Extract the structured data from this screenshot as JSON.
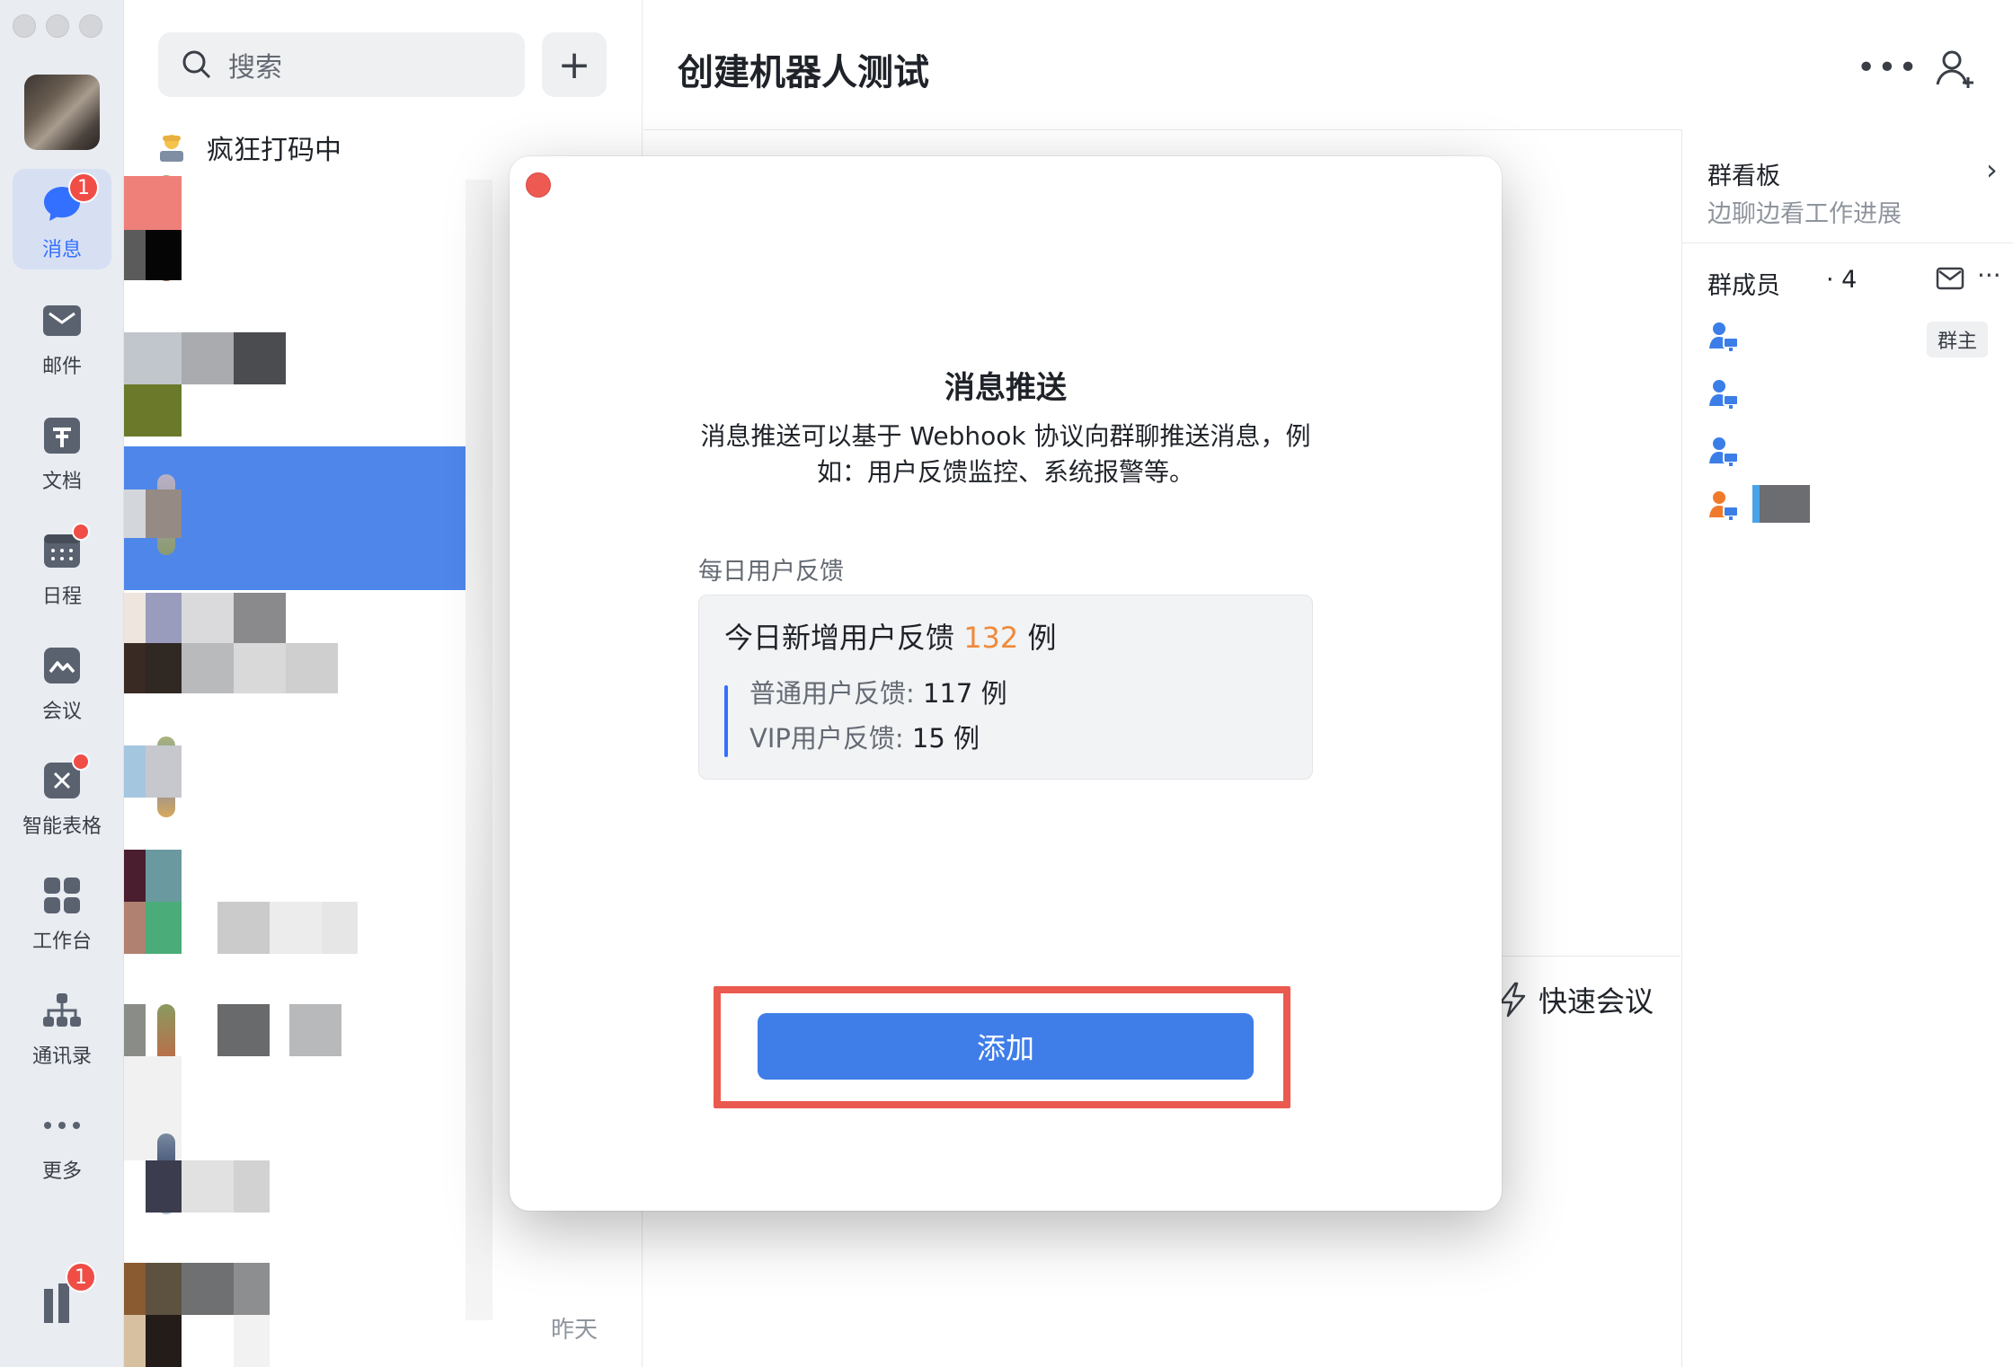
{
  "rail": {
    "items": [
      {
        "label": "消息",
        "icon": "message-icon",
        "badge": "1"
      },
      {
        "label": "邮件",
        "icon": "mail-icon"
      },
      {
        "label": "文档",
        "icon": "docs-icon"
      },
      {
        "label": "日程",
        "icon": "calendar-icon"
      },
      {
        "label": "会议",
        "icon": "meeting-icon"
      },
      {
        "label": "智能表格",
        "icon": "smart-sheet-icon"
      },
      {
        "label": "工作台",
        "icon": "workbench-icon"
      },
      {
        "label": "通讯录",
        "icon": "contacts-icon"
      },
      {
        "label": "更多",
        "icon": "more-icon"
      }
    ],
    "bottom_badge": "1"
  },
  "chatlist": {
    "search_placeholder": "搜索",
    "status_text": "疯狂打码中",
    "last_time": "昨天"
  },
  "main": {
    "chat_title": "创建机器人测试",
    "quick_meeting": "快速会议"
  },
  "side": {
    "board_title": "群看板",
    "board_sub": "边聊边看工作进展",
    "members_title": "群成员",
    "members_count": "· 4",
    "owner_tag": "群主"
  },
  "modal": {
    "title": "消息推送",
    "desc": "消息推送可以基于 Webhook 协议向群聊推送消息，例如：用户反馈监控、系统报警等。",
    "section_label": "每日用户反馈",
    "card": {
      "head_prefix": "今日新增用户反馈 ",
      "head_number": "132",
      "head_suffix": " 例",
      "normal_label": "普通用户反馈: ",
      "normal_value": "117 例",
      "vip_label": "VIP用户反馈: ",
      "vip_value": "15 例"
    },
    "add_button": "添加"
  },
  "colors": {
    "accent": "#3370ff",
    "button": "#3f7ee8",
    "highlight": "#ea5a4e",
    "badge": "#f04d47",
    "number_orange": "#f08a3c"
  }
}
